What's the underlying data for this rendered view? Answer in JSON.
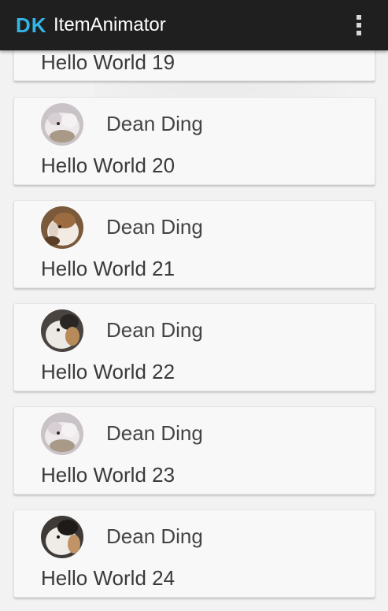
{
  "action_bar": {
    "logo": "DK",
    "title": "ItemAnimator"
  },
  "colors": {
    "accent": "#33b5e5",
    "action_bar_bg": "#1f1f1f",
    "card_bg": "#f8f8f8",
    "page_bg": "#f2f2f2"
  },
  "list": {
    "partial_item": {
      "message": "Hello World 19"
    },
    "items": [
      {
        "name": "Dean Ding",
        "message": "Hello World 20",
        "avatar_icon": "hamster-photo-icon"
      },
      {
        "name": "Dean Ding",
        "message": "Hello World 21",
        "avatar_icon": "hamster-photo-icon"
      },
      {
        "name": "Dean Ding",
        "message": "Hello World 22",
        "avatar_icon": "hamster-photo-icon"
      },
      {
        "name": "Dean Ding",
        "message": "Hello World 23",
        "avatar_icon": "hamster-photo-icon"
      },
      {
        "name": "Dean Ding",
        "message": "Hello World 24",
        "avatar_icon": "hamster-photo-icon"
      }
    ]
  }
}
